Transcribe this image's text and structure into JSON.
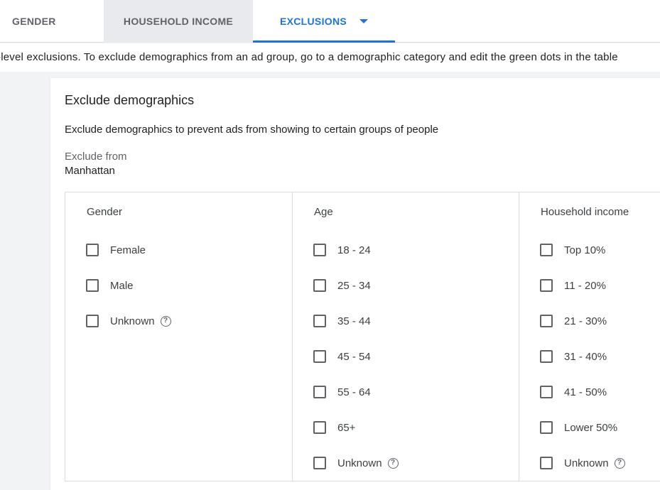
{
  "tabs": {
    "gender": "GENDER",
    "household_income": "HOUSEHOLD INCOME",
    "exclusions": "EXCLUSIONS",
    "active": "exclusions"
  },
  "info_text": "-level exclusions. To exclude demographics from an ad group, go to a demographic category and edit the green dots in the table",
  "card": {
    "title": "Exclude demographics",
    "description": "Exclude demographics to prevent ads from showing to certain groups of people",
    "exclude_from_label": "Exclude from",
    "exclude_from_value": "Manhattan"
  },
  "columns": {
    "gender": {
      "header": "Gender",
      "options": [
        {
          "label": "Female",
          "checked": false,
          "help": false
        },
        {
          "label": "Male",
          "checked": false,
          "help": false
        },
        {
          "label": "Unknown",
          "checked": false,
          "help": true
        }
      ]
    },
    "age": {
      "header": "Age",
      "options": [
        {
          "label": "18 - 24",
          "checked": false,
          "help": false
        },
        {
          "label": "25 - 34",
          "checked": false,
          "help": false
        },
        {
          "label": "35 - 44",
          "checked": false,
          "help": false
        },
        {
          "label": "45 - 54",
          "checked": false,
          "help": false
        },
        {
          "label": "55 - 64",
          "checked": false,
          "help": false
        },
        {
          "label": "65+",
          "checked": false,
          "help": false
        },
        {
          "label": "Unknown",
          "checked": false,
          "help": true
        }
      ]
    },
    "household_income": {
      "header": "Household income",
      "options": [
        {
          "label": "Top 10%",
          "checked": false,
          "help": false
        },
        {
          "label": "11 - 20%",
          "checked": false,
          "help": false
        },
        {
          "label": "21 - 30%",
          "checked": false,
          "help": false
        },
        {
          "label": "31 - 40%",
          "checked": false,
          "help": false
        },
        {
          "label": "41 - 50%",
          "checked": false,
          "help": false
        },
        {
          "label": "Lower 50%",
          "checked": false,
          "help": false
        },
        {
          "label": "Unknown",
          "checked": false,
          "help": true
        }
      ]
    }
  },
  "help_icon_glyph": "?",
  "colors": {
    "accent": "#1a73e8",
    "page_bg": "#f1f3f4"
  }
}
